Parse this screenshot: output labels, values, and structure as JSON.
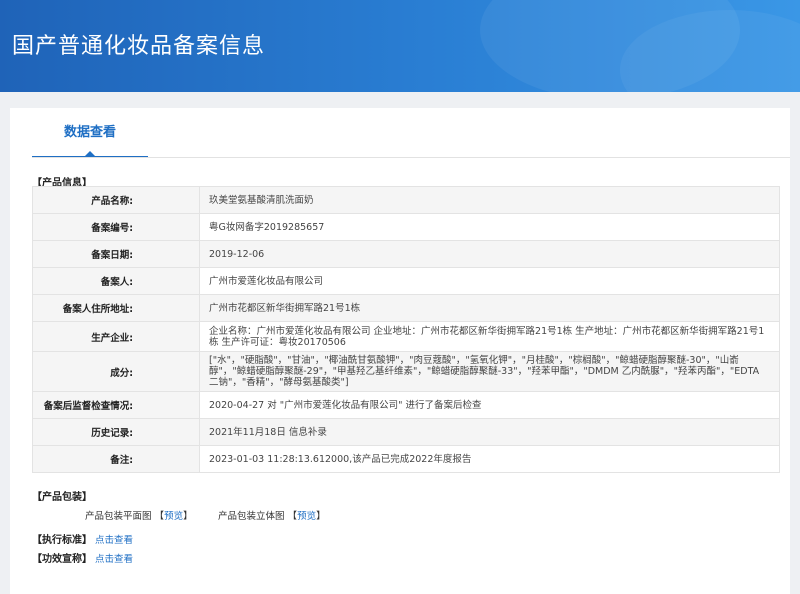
{
  "header": {
    "title": "国产普通化妆品备案信息"
  },
  "tabs": [
    {
      "label": "数据查看"
    }
  ],
  "product_info": {
    "section_title": "【产品信息】",
    "rows": [
      {
        "label": "产品名称:",
        "value": "玖美堂氨基酸清肌洗面奶"
      },
      {
        "label": "备案编号:",
        "value": "粤G妆网备字2019285657"
      },
      {
        "label": "备案日期:",
        "value": "2019-12-06"
      },
      {
        "label": "备案人:",
        "value": "广州市爱莲化妆品有限公司"
      },
      {
        "label": "备案人住所地址:",
        "value": "广州市花都区新华街拥军路21号1栋"
      },
      {
        "label": "生产企业:",
        "value": "企业名称：广州市爱莲化妆品有限公司 企业地址：广州市花都区新华街拥军路21号1栋 生产地址：广州市花都区新华街拥军路21号1栋 生产许可证：粤妆20170506"
      },
      {
        "label": "成分:",
        "value": "[\"水\"，\"硬脂酸\"，\"甘油\"，\"椰油酰甘氨酸钾\"，\"肉豆蔻酸\"，\"氢氧化钾\"，\"月桂酸\"，\"棕榈酸\"，\"鲸蜡硬脂醇聚醚-30\"，\"山嵛醇\"，\"鲸蜡硬脂醇聚醚-29\"，\"甲基羟乙基纤维素\"，\"鲸蜡硬脂醇聚醚-33\"，\"羟苯甲酯\"，\"DMDM 乙内酰脲\"，\"羟苯丙酯\"，\"EDTA 二钠\"，\"香精\"，\"酵母氨基酸类\"]"
      },
      {
        "label": "备案后监督检查情况:",
        "value": "2020-04-27 对 \"广州市爱莲化妆品有限公司\" 进行了备案后检查"
      },
      {
        "label": "历史记录:",
        "value": "2021年11月18日 信息补录"
      },
      {
        "label": "备注:",
        "value": "2023-01-03 11:28:13.612000,该产品已完成2022年度报告"
      }
    ]
  },
  "packaging": {
    "section_title": "【产品包装】",
    "flat_label": "产品包装平面图",
    "flat_link": "预览",
    "stereo_label": "产品包装立体图",
    "stereo_link": "预览",
    "bracket_open": "【",
    "bracket_close": "】"
  },
  "standard": {
    "section_title": "【执行标准】",
    "link": "点击查看"
  },
  "efficacy": {
    "section_title": "【功效宣称】",
    "link": "点击查看"
  }
}
